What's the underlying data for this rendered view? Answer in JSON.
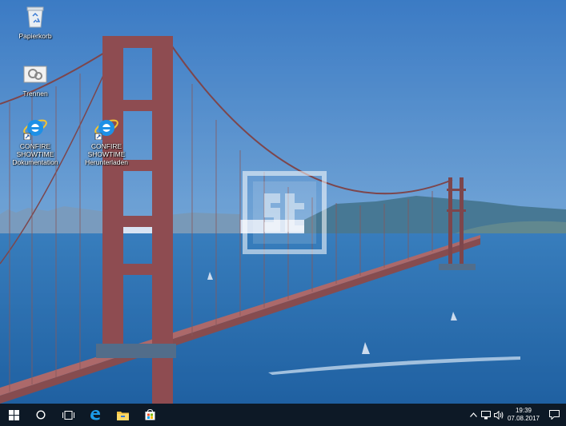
{
  "desktop": {
    "icons": [
      {
        "label": "Papierkorb",
        "icon": "recycle-bin-icon"
      },
      {
        "label": "Trennen",
        "icon": "disconnect-icon"
      },
      {
        "label": "CONFIRE SHOWTIME\nDokumentation",
        "icon": "internet-explorer-icon"
      },
      {
        "label": "CONFIRE SHOWTIME\nHerunterladen",
        "icon": "internet-explorer-icon"
      }
    ],
    "wallpaper": "golden-gate-bridge",
    "watermark_text": "st"
  },
  "taskbar": {
    "buttons": [
      {
        "name": "start-button",
        "icon": "windows-logo-icon"
      },
      {
        "name": "search-button",
        "icon": "cortana-circle-icon"
      },
      {
        "name": "task-view-button",
        "icon": "task-view-icon"
      },
      {
        "name": "edge-button",
        "icon": "edge-icon"
      },
      {
        "name": "file-explorer-button",
        "icon": "folder-icon"
      },
      {
        "name": "store-button",
        "icon": "store-icon"
      }
    ],
    "tray": {
      "icons": [
        "chevron-up-icon",
        "network-icon",
        "volume-icon"
      ],
      "time": "19:39",
      "date": "07.08.2017",
      "notification_icon": "action-center-icon"
    }
  },
  "colors": {
    "taskbar": "#0d1926",
    "sky": "#4a86c8",
    "water": "#2f78b6",
    "bridge": "#b5463b"
  }
}
